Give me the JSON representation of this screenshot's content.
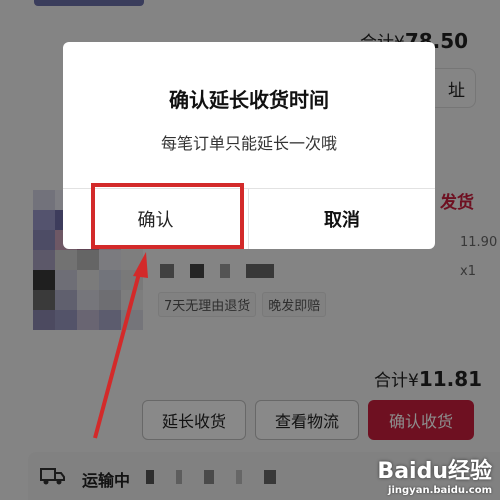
{
  "background_page": {
    "order_total_top": {
      "prefix": "合计¥",
      "amount": "78.50"
    },
    "address_button_label": "址",
    "order_status": "发货",
    "item_price": "11.90",
    "item_quantity": "x1",
    "tags": [
      "7天无理由退货",
      "晚发即赔"
    ],
    "order_total_bottom": {
      "prefix": "合计¥",
      "amount": "11.81"
    },
    "actions": {
      "extend_label": "延长收货",
      "logistics_label": "查看物流",
      "confirm_receipt_label": "确认收货"
    },
    "shipping_status": "运输中"
  },
  "dialog": {
    "title": "确认延长收货时间",
    "message": "每笔订单只能延长一次哦",
    "confirm_label": "确认",
    "cancel_label": "取消"
  },
  "annotation": {
    "highlight_color": "#d32a2a"
  },
  "watermark": {
    "brand": "Baidu经验",
    "url": "jingyan.baidu.com"
  },
  "colors": {
    "accent": "#c81e3c",
    "overlay": "rgba(0,0,0,0.45)"
  }
}
